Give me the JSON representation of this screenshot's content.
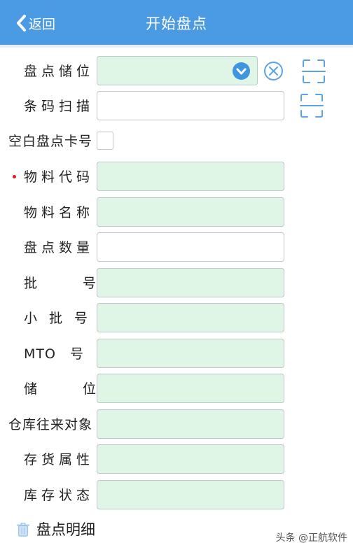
{
  "header": {
    "back_label": "返回",
    "title": "开始盘点"
  },
  "form": {
    "bin_label": "盘点储位",
    "barcode_label": "条码扫描",
    "blank_card_label": "空白盘点卡号",
    "material_code_label": "物料代码",
    "material_name_label": "物料名称",
    "count_qty_label": "盘点数量",
    "batch_label": "批　号",
    "sub_batch_label": "小批号",
    "mto_label": "MTO　号",
    "location_label": "储　位",
    "counterparty_label": "仓库往来对象",
    "inventory_attr_label": "存货属性",
    "stock_status_label": "库存状态"
  },
  "footer": {
    "detail_label": "盘点明细"
  },
  "watermark": "头条 @正航软件",
  "colors": {
    "header_bg": "#4a9be3",
    "field_green": "#dff5e6",
    "accent_blue": "#3f95df",
    "required_dot": "#e02020"
  },
  "icons": [
    "chevron-left-icon",
    "chevron-down-icon",
    "clear-circle-icon",
    "scan-frame-icon",
    "trash-icon"
  ]
}
